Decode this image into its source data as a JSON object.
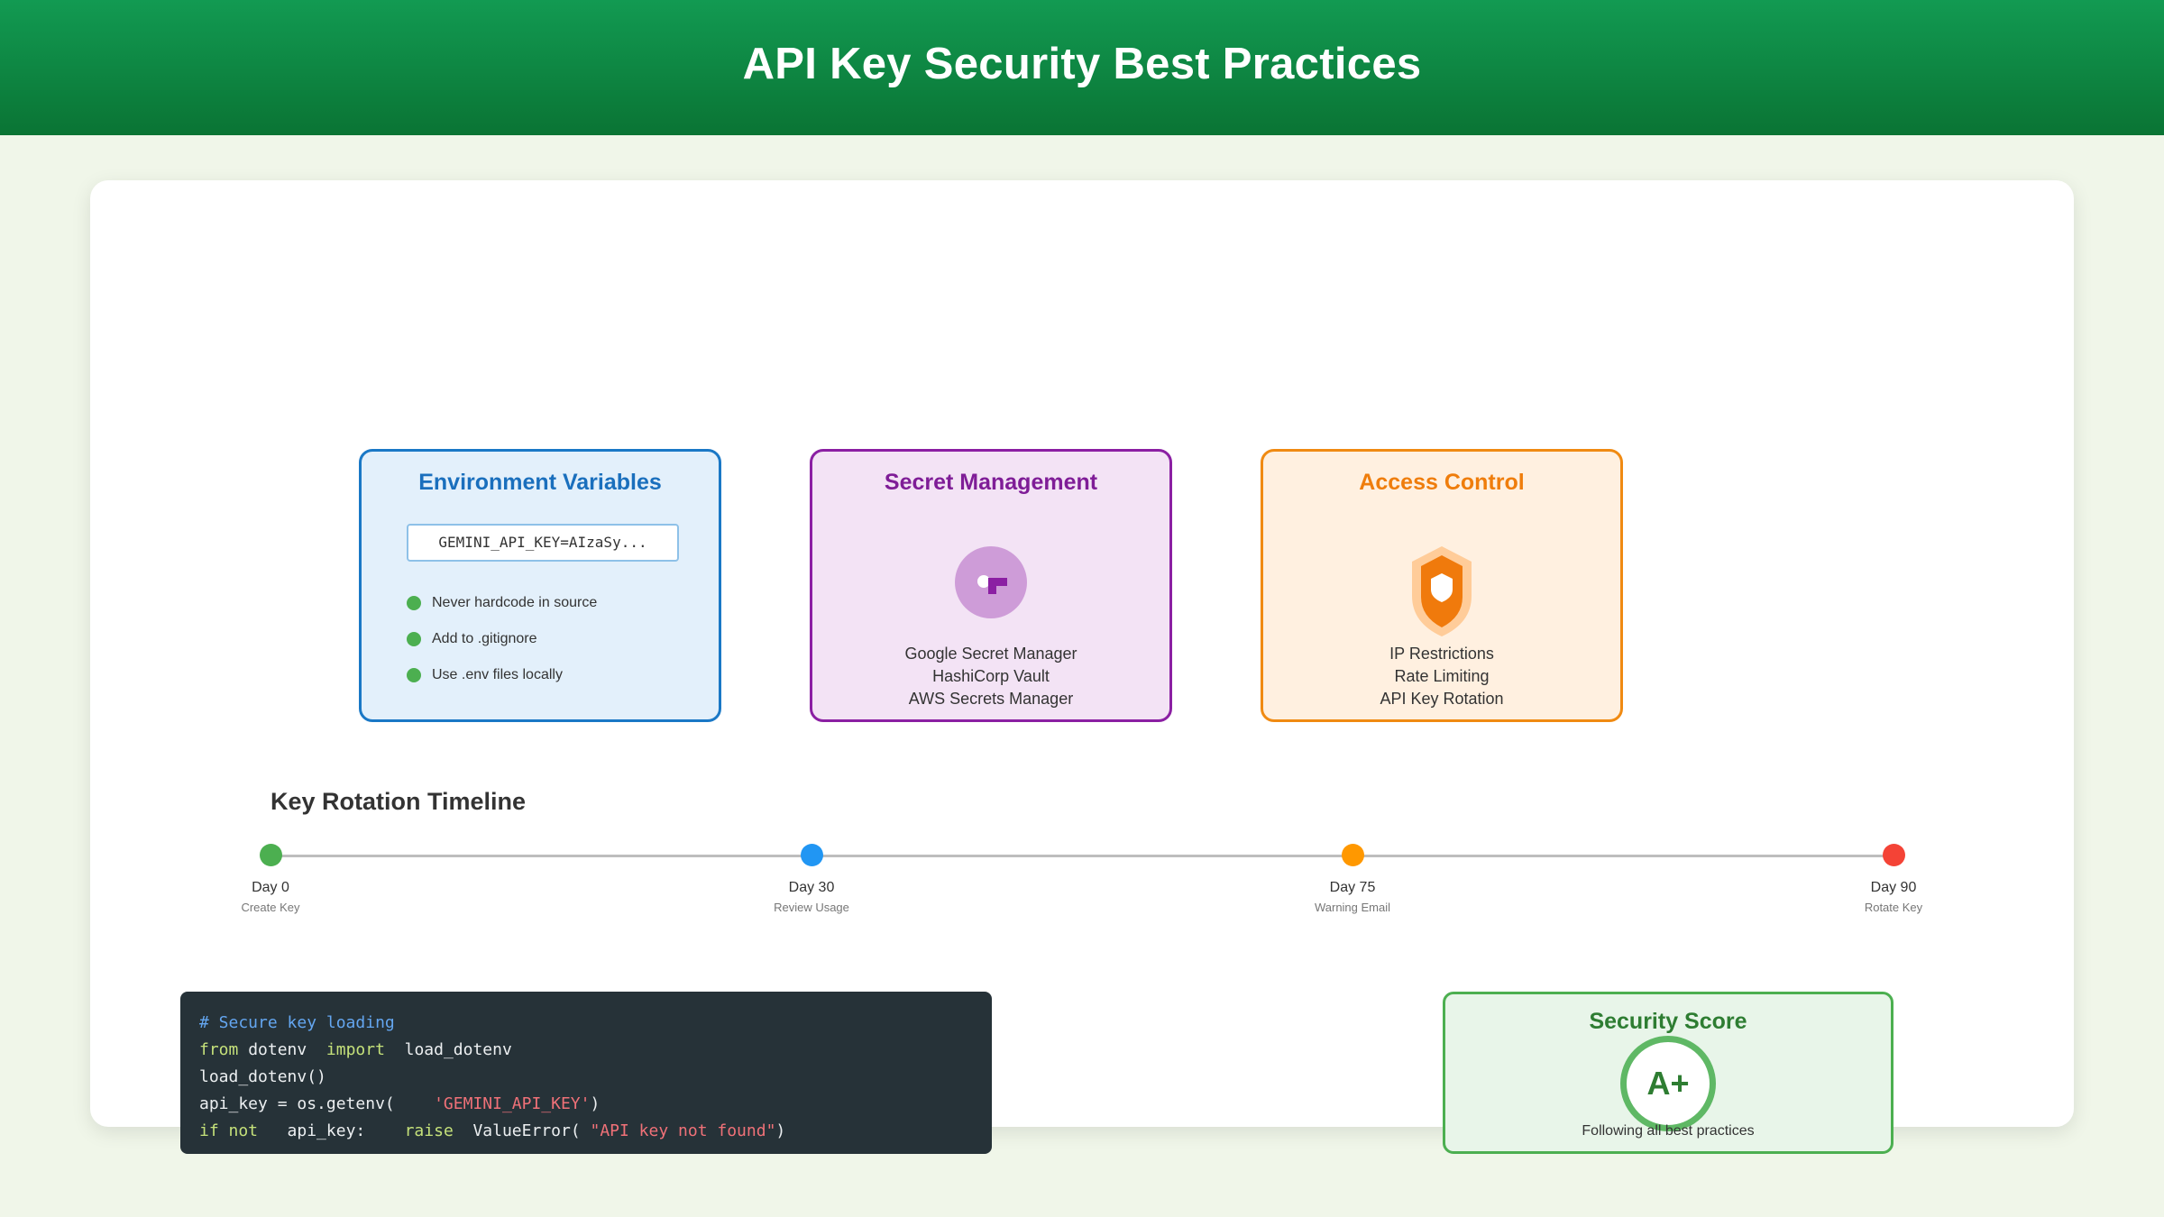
{
  "header": {
    "title": "API Key Security Best Practices"
  },
  "cards": {
    "env": {
      "title": "Environment Variables",
      "field_value": "GEMINI_API_KEY=AIzaSy...",
      "items": [
        "Never hardcode in source",
        "Add to .gitignore",
        "Use .env files locally"
      ]
    },
    "secret": {
      "title": "Secret Management",
      "icon": "key-icon",
      "lines": [
        "Google Secret Manager",
        "HashiCorp Vault",
        "AWS Secrets Manager"
      ]
    },
    "access": {
      "title": "Access Control",
      "icon": "shield-icon",
      "lines": [
        "IP Restrictions",
        "Rate Limiting",
        "API Key Rotation"
      ]
    }
  },
  "timeline": {
    "title": "Key Rotation Timeline",
    "nodes": [
      {
        "day": "Day 0",
        "action": "Create Key",
        "color": "#4caf50"
      },
      {
        "day": "Day 30",
        "action": "Review Usage",
        "color": "#2196f3"
      },
      {
        "day": "Day 75",
        "action": "Warning Email",
        "color": "#ff9800"
      },
      {
        "day": "Day 90",
        "action": "Rotate Key",
        "color": "#f44336"
      }
    ]
  },
  "code": {
    "line1": "# Secure key loading",
    "l2_kw1": "from",
    "l2_mod": " dotenv  ",
    "l2_kw2": "import",
    "l2_name": "  load_dotenv",
    "line3": "load_dotenv()",
    "l4_pre": "api_key = os.getenv(    ",
    "l4_str": "'GEMINI_API_KEY'",
    "l4_post": ")",
    "l5_kw1": "if not",
    "l5_mid": "   api_key:    ",
    "l5_kw2": "raise",
    "l5_call": "  ValueError( ",
    "l5_str": "\"API key not found\"",
    "l5_post": ")"
  },
  "score": {
    "title": "Security Score",
    "grade": "A+",
    "caption": "Following all best practices"
  },
  "colors": {
    "header": "#0f8a45",
    "env": "#1a78c6",
    "secret": "#8b1fa3",
    "access": "#f08a12",
    "score": "#4caf50"
  }
}
